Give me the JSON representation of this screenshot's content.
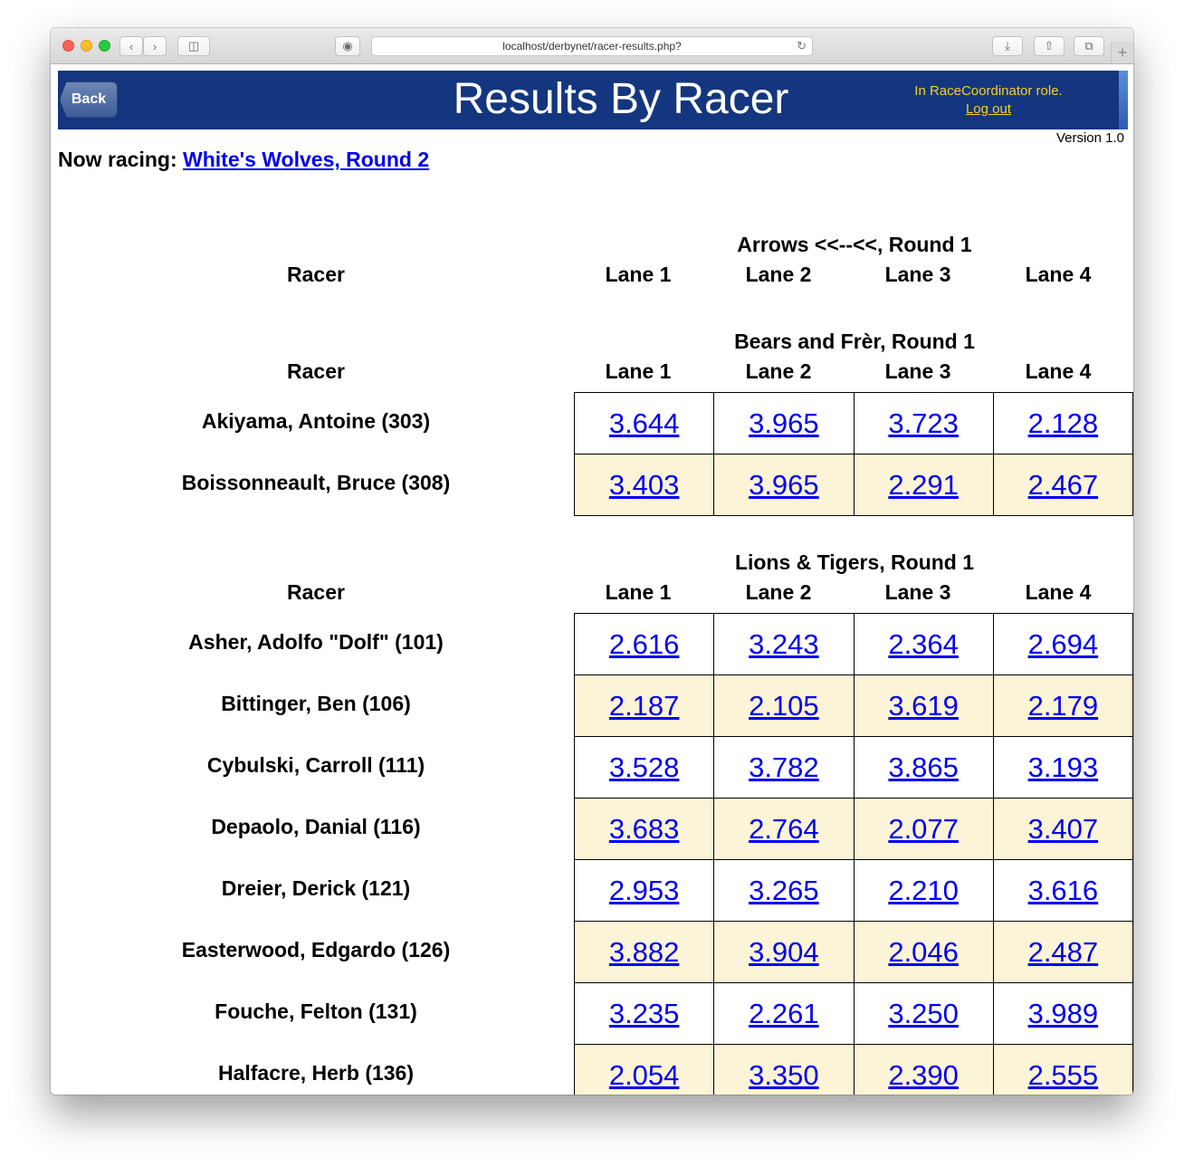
{
  "browser": {
    "url": "localhost/derbynet/racer-results.php?"
  },
  "header": {
    "back_label": "Back",
    "title": "Results By Racer",
    "role_text": "In RaceCoordinator role.",
    "logout_label": "Log out",
    "version": "Version 1.0"
  },
  "now_racing": {
    "label": "Now racing:",
    "link": "White's Wolves, Round 2"
  },
  "columns": {
    "racer": "Racer",
    "lanes": [
      "Lane 1",
      "Lane 2",
      "Lane 3",
      "Lane 4"
    ]
  },
  "groups": [
    {
      "title": "Arrows <<--<<, Round 1",
      "rows": []
    },
    {
      "title": "Bears and Frèr, Round 1",
      "rows": [
        {
          "racer": "Akiyama, Antoine (303)",
          "times": [
            "3.644",
            "3.965",
            "3.723",
            "2.128"
          ]
        },
        {
          "racer": "Boissonneault, Bruce (308)",
          "times": [
            "3.403",
            "3.965",
            "2.291",
            "2.467"
          ]
        }
      ]
    },
    {
      "title": "Lions & Tigers, Round 1",
      "rows": [
        {
          "racer": "Asher, Adolfo \"Dolf\" (101)",
          "times": [
            "2.616",
            "3.243",
            "2.364",
            "2.694"
          ]
        },
        {
          "racer": "Bittinger, Ben (106)",
          "times": [
            "2.187",
            "2.105",
            "3.619",
            "2.179"
          ]
        },
        {
          "racer": "Cybulski, Carroll (111)",
          "times": [
            "3.528",
            "3.782",
            "3.865",
            "3.193"
          ]
        },
        {
          "racer": "Depaolo, Danial (116)",
          "times": [
            "3.683",
            "2.764",
            "2.077",
            "3.407"
          ]
        },
        {
          "racer": "Dreier, Derick (121)",
          "times": [
            "2.953",
            "3.265",
            "2.210",
            "3.616"
          ]
        },
        {
          "racer": "Easterwood, Edgardo (126)",
          "times": [
            "3.882",
            "3.904",
            "2.046",
            "2.487"
          ]
        },
        {
          "racer": "Fouche, Felton (131)",
          "times": [
            "3.235",
            "2.261",
            "3.250",
            "3.989"
          ]
        },
        {
          "racer": "Halfacre, Herb (136)",
          "times": [
            "2.054",
            "3.350",
            "2.390",
            "2.555"
          ]
        }
      ]
    }
  ]
}
